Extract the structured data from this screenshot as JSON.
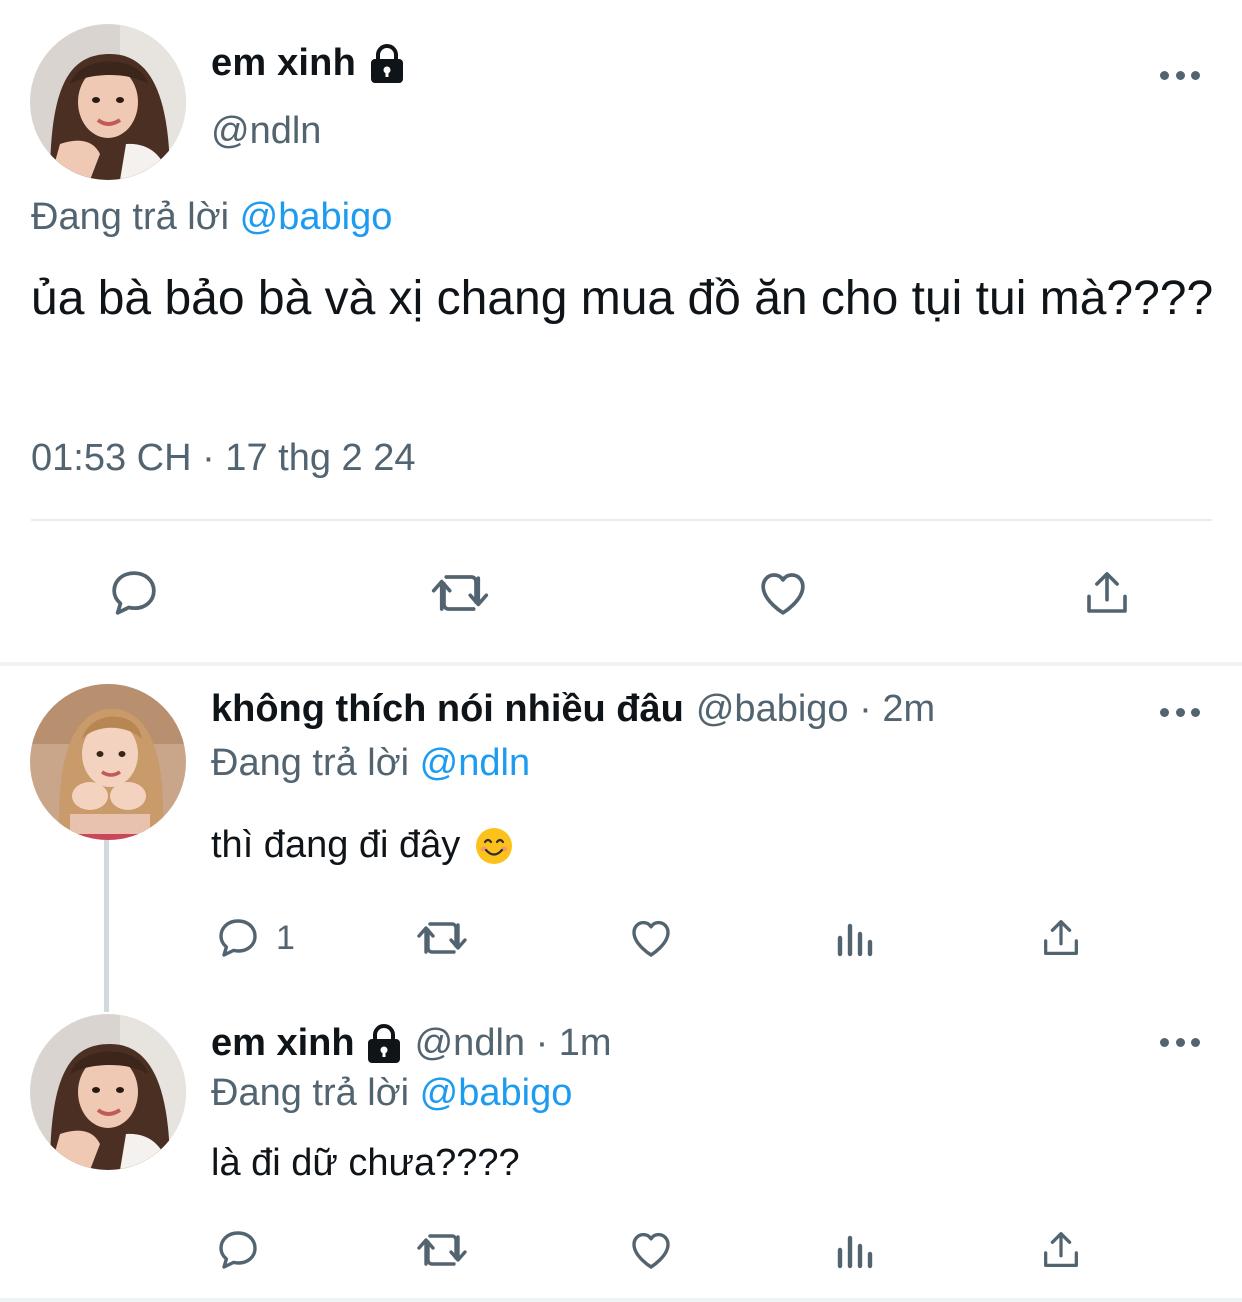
{
  "main_tweet": {
    "display_name": "em xinh",
    "handle": "@ndln",
    "replying_prefix": "Đang trả lời",
    "replying_to": "@babigo",
    "text": "ủa bà bảo bà và xị chang mua đồ ăn cho tụi tui mà????",
    "timestamp": "01:53 CH · 17 thg 2 24",
    "actions": [
      "reply-icon",
      "retweet-icon",
      "like-icon",
      "share-icon"
    ]
  },
  "replies": [
    {
      "display_name": "không thích nói nhiều đâu",
      "meta": "@babigo · 2m",
      "replying_prefix": "Đang trả lời",
      "replying_to": "@ndln",
      "text": "thì đang đi đây",
      "emoji": "smiling-face-icon",
      "reply_count": "1",
      "actions": [
        "reply-icon",
        "retweet-icon",
        "like-icon",
        "analytics-icon",
        "share-icon"
      ]
    },
    {
      "display_name": "em xinh",
      "meta": "@ndln · 1m",
      "replying_prefix": "Đang trả lời",
      "replying_to": "@babigo",
      "text": "là đi dữ chưa????",
      "reply_count": "",
      "actions": [
        "reply-icon",
        "retweet-icon",
        "like-icon",
        "analytics-icon",
        "share-icon"
      ]
    }
  ],
  "colors": {
    "text": "#0f1419",
    "secondary": "#536471",
    "accent": "#1d9bf0",
    "divider": "#eff3f4"
  }
}
